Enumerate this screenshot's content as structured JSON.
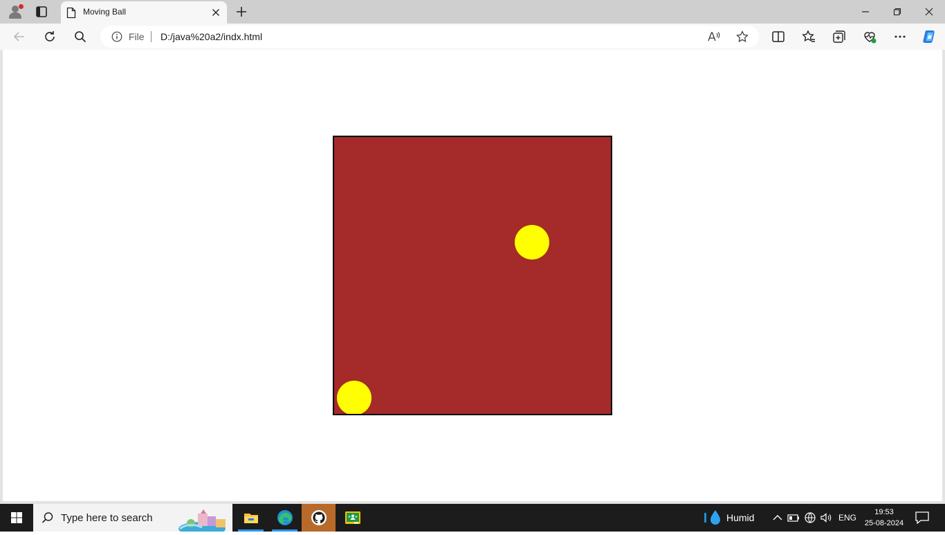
{
  "browser": {
    "tab": {
      "title": "Moving Ball"
    },
    "address_bar": {
      "scheme_label": "File",
      "url": "D:/java%20a2/indx.html"
    }
  },
  "icons": [
    "profile-icon",
    "tab-actions-icon",
    "page-icon",
    "close-icon",
    "plus-icon",
    "minimize-icon",
    "restore-icon",
    "back-icon",
    "refresh-icon",
    "search-icon",
    "info-icon",
    "read-aloud-icon",
    "star-icon",
    "split-screen-icon",
    "favorites-icon",
    "collections-icon",
    "performance-icon",
    "more-icon",
    "copilot-icon",
    "windows-icon",
    "file-explorer-icon",
    "edge-icon",
    "github-icon",
    "classroom-icon",
    "water-drop-icon",
    "chevron-up-icon",
    "battery-icon",
    "network-icon",
    "volume-icon",
    "notification-icon"
  ],
  "page": {
    "canvas": {
      "background": "#a52a2a",
      "border_color": "#000000",
      "ball_color": "#ffff00"
    }
  },
  "taskbar": {
    "search_placeholder": "Type here to search",
    "weather": "Humid",
    "language": "ENG",
    "time": "19:53",
    "date": "25-08-2024",
    "active_accent": "#2e95f6"
  }
}
